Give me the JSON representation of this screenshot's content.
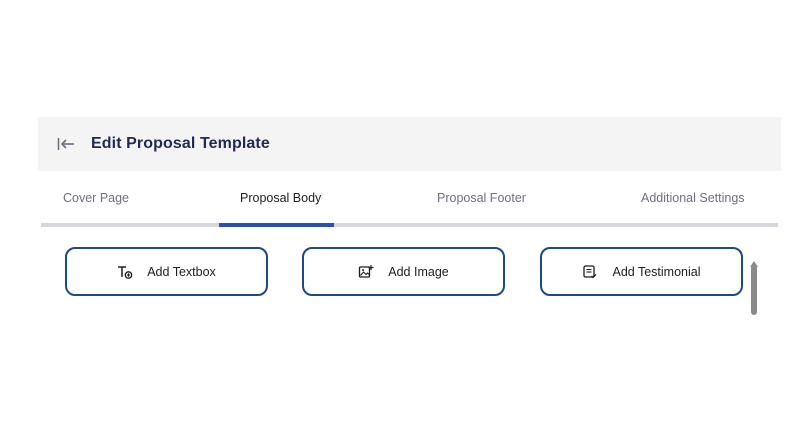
{
  "header": {
    "title": "Edit Proposal Template",
    "back_icon": "collapse-left-arrow-icon"
  },
  "tabs": [
    {
      "label": "Cover Page",
      "active": false
    },
    {
      "label": "Proposal Body",
      "active": true
    },
    {
      "label": "Proposal Footer",
      "active": false
    },
    {
      "label": "Additional Settings",
      "active": false
    }
  ],
  "actions": [
    {
      "label": "Add Textbox",
      "icon": "textbox-icon"
    },
    {
      "label": "Add Image",
      "icon": "image-add-icon"
    },
    {
      "label": "Add Testimonial",
      "icon": "testimonial-icon"
    }
  ],
  "colors": {
    "accent": "#2850b8",
    "button_border": "#1b4a86",
    "title": "#1f2a56",
    "header_bg": "#f4f4f5"
  }
}
